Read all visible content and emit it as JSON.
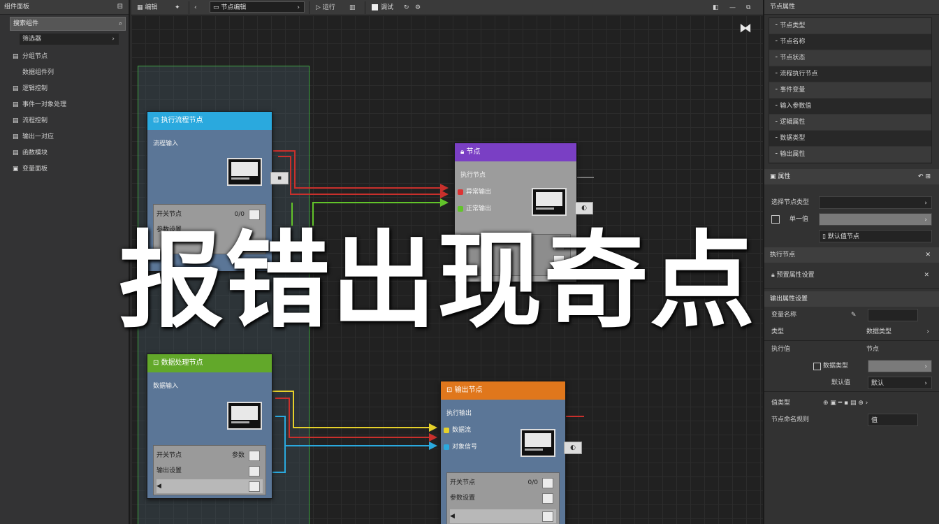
{
  "left_panel": {
    "title": "组件面板",
    "search_placeholder": "搜索组件",
    "sub_filter": "筛选器",
    "items": [
      {
        "icon": "▤",
        "label": "分组节点"
      },
      {
        "icon": "",
        "label": "数据组件列",
        "indent": true
      },
      {
        "icon": "▤",
        "label": "逻辑控制"
      },
      {
        "icon": "▤",
        "label": "事件一对象处理"
      },
      {
        "icon": "▤",
        "label": "流程控制"
      },
      {
        "icon": "▤",
        "label": "输出一对应"
      },
      {
        "icon": "▤",
        "label": "函数模块"
      },
      {
        "icon": "▣",
        "label": "变量面板"
      }
    ]
  },
  "toolbar": {
    "btn1": "编辑",
    "btn2": "",
    "dropdown": "节点编辑",
    "btn3": "运行",
    "checkbox": "调试"
  },
  "nodes": {
    "blue": {
      "title": "执行流程节点",
      "port": "流程输入",
      "row1": "开关节点",
      "row1v": "0/0",
      "row2": "参数设置",
      "accent": "#2aa9de"
    },
    "green": {
      "title": "数据处理节点",
      "port": "数据输入",
      "row1": "开关节点",
      "row1v": "参数",
      "row2": "输出设置",
      "accent": "#62a82a"
    },
    "purple": {
      "title": "节点",
      "port": "执行节点",
      "in1": "异常输出",
      "in2": "正常输出",
      "row1": "",
      "accent": "#7a3fc4"
    },
    "orange": {
      "title": "输出节点",
      "port": "执行输出",
      "in1": "数据流",
      "in2": "对象信号",
      "row1": "开关节点",
      "row1v": "0/0",
      "row2": "参数设置",
      "accent": "#e0771c"
    }
  },
  "right_panel": {
    "title": "节点属性",
    "list": [
      "节点类型",
      "节点名称",
      "节点状态",
      "流程执行节点",
      "事件变量",
      "输入参数值",
      "逻辑属性",
      "数据类型",
      "输出属性"
    ],
    "section1": "属性",
    "row_a_label": "选择节点类型",
    "row_b_label": "单一值",
    "row_b_sub": "默认值节点",
    "section2": "执行节点",
    "section3_item": "预置属性设置",
    "section4": "输出属性设置",
    "row_c_label": "变量名称",
    "row_d_label": "类型",
    "row_d_value": "数据类型",
    "row_e_label": "执行值",
    "row_e_value": "节点",
    "row_f_check": "数据类型",
    "row_g_label": "默认值",
    "row_g_value": "默认",
    "row_h_label": "值类型",
    "row_i_label": "节点命名规则",
    "row_i_value": "值"
  },
  "overlay_text": "报错出现奇点"
}
